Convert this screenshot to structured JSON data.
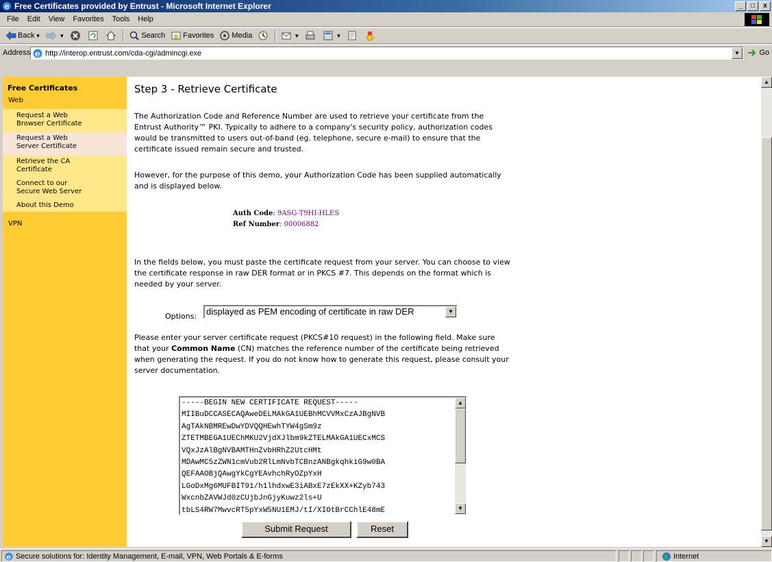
{
  "window": {
    "title": "Free Certificates provided by Entrust - Microsoft Internet Explorer",
    "controls": {
      "minimize": "_",
      "maximize": "□",
      "close": "x"
    }
  },
  "menu": [
    "File",
    "Edit",
    "View",
    "Favorites",
    "Tools",
    "Help"
  ],
  "toolbar": {
    "back": "Back",
    "search": "Search",
    "favorites": "Favorites",
    "media": "Media"
  },
  "address": {
    "label": "Address",
    "url": "http://interop.entrust.com/cda-cgi/admincgi.exe",
    "go": "Go"
  },
  "sidebar": {
    "title": "Free Certificates",
    "web": "Web",
    "items": [
      {
        "line1": "Request a Web",
        "line2": "Browser Certificate"
      },
      {
        "line1": "Request a Web",
        "line2": "Server Certificate"
      },
      {
        "line1": "Retrieve the CA",
        "line2": "Certificate"
      },
      {
        "line1": "Connect to our",
        "line2": "Secure Web Server"
      },
      {
        "line1": "About this Demo",
        "line2": ""
      }
    ],
    "vpn": "VPN"
  },
  "page": {
    "heading": "Step 3 - Retrieve Certificate",
    "para1": "The Authorization Code and Reference Number are used to retrieve your certificate from the Entrust Authority™ PKI. Typically to adhere to a company's security policy, authorization codes would be transmitted to users out-of-band (eg. telephone, secure e-mail) to ensure that the certificate issued remain secure and trusted.",
    "para2": "However, for the purpose of this demo, your Authorization Code has been supplied automatically and is displayed below.",
    "auth_label": "Auth Code",
    "auth_value": "9ASG-T9HI-HLES",
    "ref_label": "Ref Number",
    "ref_value": "00006882",
    "para3": "In the fields below, you must paste the certificate request from your server. You can choose to view the certificate response in raw DER format or in PKCS #7. This depends on the format which is needed by your server.",
    "options_label": "Options:",
    "options_value": "displayed as PEM encoding of certificate in raw DER",
    "para4_a": "Please enter your server certificate request (PKCS#10 request) in the following field. Make sure that your ",
    "para4_bold": "Common Name",
    "para4_b": " (CN) matches the reference number of the certificate being retrieved when generating the request. If you do not know how to generate this request, please consult your server documentation.",
    "request_lines": [
      "-----BEGIN NEW CERTIFICATE REQUEST-----",
      "MIIBuDCCASECAQAweDELMAkGA1UEBhMCVVMxCzAJBgNVB",
      "AgTAkNBMREwDwYDVQQHEwhTYW4gSm9z",
      "ZTETMBEGA1UEChMKU2VjdXJlbm9kZTELMAkGA1UECxMCS",
      "VQxJzAlBgNVBAMTHnZvbHRhZ2UtcHMt",
      "MDAwMC5zZWN1cmVub2RlLmNvbTCBnzANBgkqhkiG9w0BA",
      "QEFAAOBjQAwgYkCgYEAvhchRyOZpYxH",
      "LGoDxMg6MUFBIT91/h1lhdxwE3iABxE7zEkXX+KZyb743",
      "WxcnbZAVWJd0zCUjbJnGjyKuwz2ls+U",
      "tbLS4RW7MwvcRT5pYxW5NU1EMJ/tI/XIOtBrCChlE48mE"
    ],
    "submit": "Submit Request",
    "reset": "Reset"
  },
  "status": {
    "text": "Secure solutions for: Identity Management, E-mail, VPN, Web Portals & E-forms",
    "zone": "Internet"
  }
}
